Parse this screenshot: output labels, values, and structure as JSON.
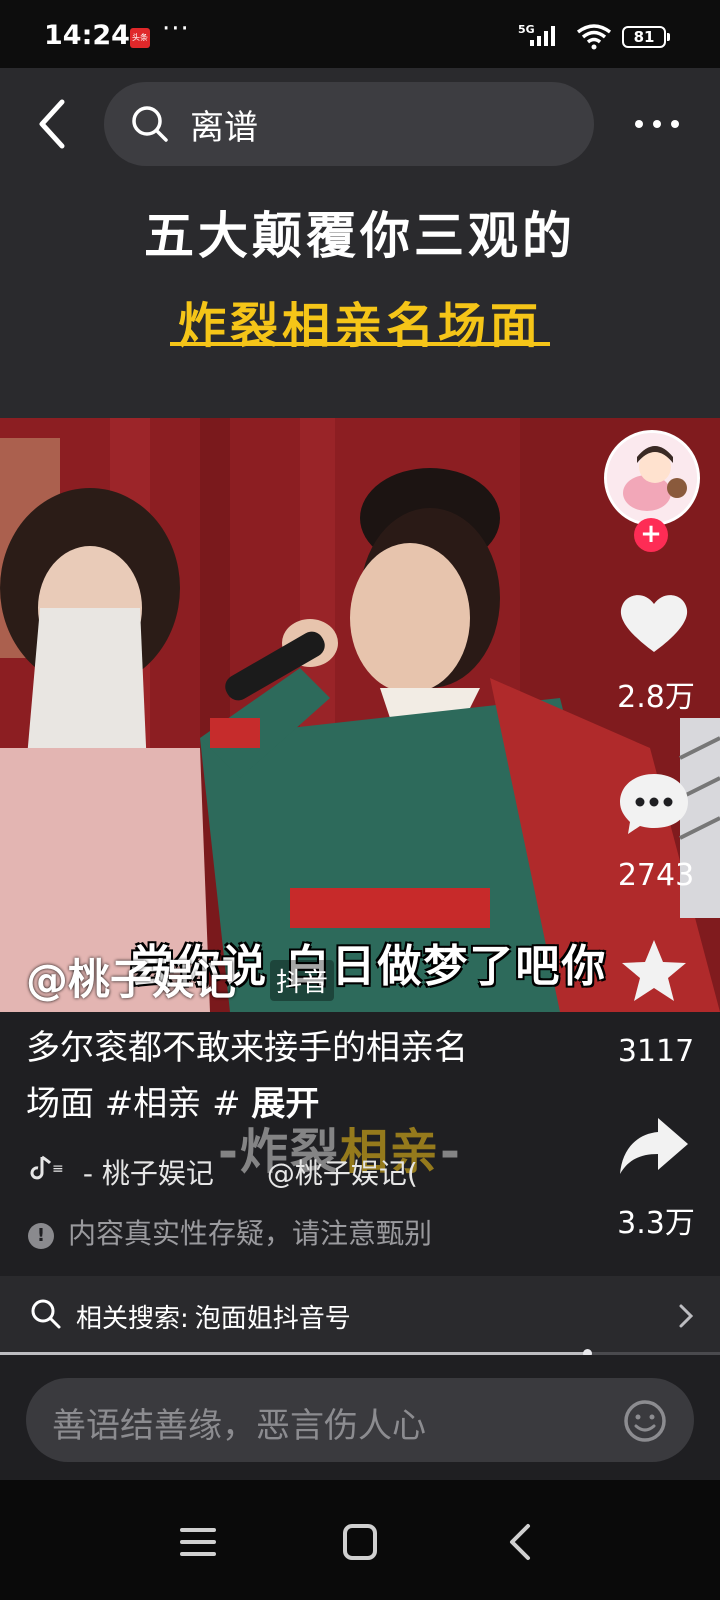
{
  "status_bar": {
    "time": "14:24",
    "app_badge": "头条",
    "dots": "···",
    "network": "5G",
    "battery": "81"
  },
  "search": {
    "query": "离谱"
  },
  "banner": {
    "line1": "五大颠覆你三观的",
    "line2": "炸裂相亲名场面"
  },
  "video": {
    "subtitle": "尝你说 白日做梦了吧你",
    "watermark": "@桃子娱记",
    "watermark_platform": "抖音",
    "overlay_left": "-炸裂",
    "overlay_hl": "相亲",
    "overlay_right": "-"
  },
  "post": {
    "description": "多尔衮都不敢来接手的相亲名场面 #相亲 #",
    "expand_label": "展开",
    "music_author": "- 桃子娱记",
    "music_handle": "@桃子娱记(",
    "warning": "内容真实性存疑，请注意甄别"
  },
  "actions": {
    "likes": "2.8万",
    "comments": "2743",
    "favorites": "3117",
    "shares": "3.3万"
  },
  "related": {
    "label": "相关搜索:",
    "query": "泡面姐抖音号"
  },
  "progress": {
    "fraction": 0.815
  },
  "comment_input": {
    "placeholder": "善语结善缘，恶言伤人心"
  },
  "colors": {
    "accent_pink": "#fe2c55",
    "banner_yellow": "#f5c518"
  },
  "icons": [
    "back-icon",
    "search-icon",
    "more-icon",
    "heart-icon",
    "comment-icon",
    "star-icon",
    "share-icon",
    "music-icon",
    "warning-icon",
    "chevron-right-icon",
    "emoji-icon",
    "menu-icon",
    "home-icon",
    "back-nav-icon"
  ]
}
